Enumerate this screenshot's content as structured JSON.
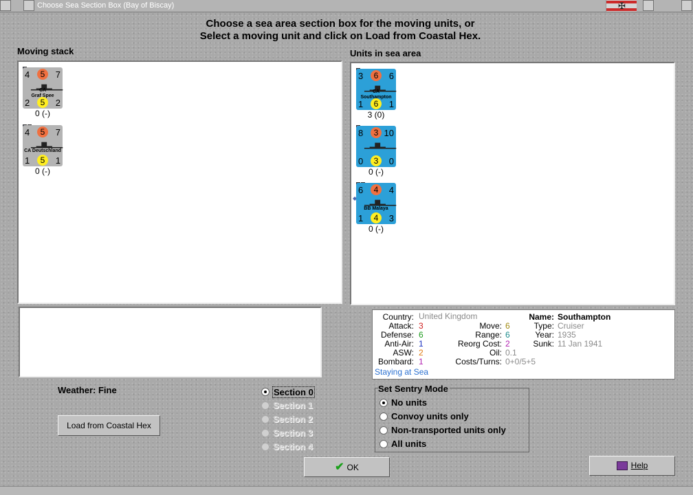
{
  "window": {
    "title": "Choose Sea Section Box (Bay of Biscay)"
  },
  "instructions": {
    "line1": "Choose a sea area section box for the moving units, or",
    "line2": "Select a moving unit and click on Load from Coastal Hex."
  },
  "moving_stack": {
    "label": "Moving stack",
    "units": [
      {
        "tl": "4",
        "tc": "5",
        "tr": "7",
        "class_line1": "CA",
        "class_line2": "Graf Spee",
        "bl": "2",
        "bc": "5",
        "br": "2",
        "below": "0 (-)",
        "color": "#b4b4b4",
        "flag_colors": [
          "#3a4a8a"
        ]
      },
      {
        "tl": "4",
        "tc": "5",
        "tr": "7",
        "class_line1": "",
        "class_line2": "CA Deutschland",
        "bl": "1",
        "bc": "5",
        "br": "1",
        "below": "0 (-)",
        "color": "#b4b4b4",
        "flag_colors": [
          "#3a4a8a",
          "#e08a1a"
        ]
      }
    ]
  },
  "sea_area": {
    "label": "Units in sea area",
    "units": [
      {
        "tl": "3",
        "tc": "6",
        "tr": "6",
        "class_line1": "CA",
        "class_line2": "Southampton",
        "bl": "1",
        "bc": "6",
        "br": "1",
        "below": "3 (0)",
        "color": "#2ca0d8",
        "flag_colors": [
          "#3a4a8a"
        ]
      },
      {
        "tl": "8",
        "tc": "3",
        "tr": "10",
        "class_line1": "",
        "class_line2": "",
        "bl": "0",
        "bc": "3",
        "br": "0",
        "below": "0 (-)",
        "color": "#2ca0d8",
        "flag_colors": [
          "#c0309a"
        ]
      },
      {
        "tl": "6",
        "tc": "4",
        "tr": "4",
        "class_line1": "",
        "class_line2": "BB Malaya",
        "bl": "1",
        "bc": "4",
        "br": "3",
        "below": "0 (-)",
        "color": "#2ca0d8",
        "flag_colors": [
          "#3a4a8a",
          "#e08a1a"
        ]
      }
    ]
  },
  "unit_info": {
    "country_label": "Country:",
    "country": "United Kingdom",
    "attack_label": "Attack:",
    "attack": "3",
    "defense_label": "Defense:",
    "defense": "6",
    "antiair_label": "Anti-Air:",
    "antiair": "1",
    "asw_label": "ASW:",
    "asw": "2",
    "bombard_label": "Bombard:",
    "bombard": "1",
    "move_label": "Move:",
    "move": "6",
    "range_label": "Range:",
    "range": "6",
    "reorg_label": "Reorg Cost:",
    "reorg": "2",
    "oil_label": "Oil:",
    "oil": "0.1",
    "costs_label": "Costs/Turns:",
    "costs": "0+0/5+5",
    "name_label": "Name:",
    "name": "Southampton",
    "type_label": "Type:",
    "type": "Cruiser",
    "year_label": "Year:",
    "year": "1935",
    "sunk_label": "Sunk:",
    "sunk": "11 Jan 1941",
    "status": "Staying at Sea",
    "colors": {
      "country": "#8a8a8a",
      "attack": "#d02020",
      "defense": "#1a9a1a",
      "antiair": "#1a30c0",
      "asw": "#e07a10",
      "bombard": "#b020b0",
      "move": "#a08a10",
      "range": "#1a8a8a",
      "reorg": "#b020b0",
      "oil": "#8a8a8a",
      "costs": "#8a8a8a",
      "grey": "#8a8a8a",
      "status": "#2a70d0"
    }
  },
  "weather": "Weather: Fine",
  "load_button": "Load from Coastal Hex",
  "sections": [
    {
      "label": "Section 0",
      "selected": true,
      "enabled": true
    },
    {
      "label": "Section 1",
      "selected": false,
      "enabled": false
    },
    {
      "label": "Section 2",
      "selected": false,
      "enabled": false
    },
    {
      "label": "Section 3",
      "selected": false,
      "enabled": false
    },
    {
      "label": "Section 4",
      "selected": false,
      "enabled": false
    }
  ],
  "sentry": {
    "title": "Set Sentry Mode",
    "options": [
      {
        "label": "No units",
        "selected": true
      },
      {
        "label": "Convoy units only",
        "selected": false
      },
      {
        "label": "Non-transported units only",
        "selected": false
      },
      {
        "label": "All units",
        "selected": false
      }
    ]
  },
  "ok_button": "OK",
  "help_button": "Help",
  "icons": {
    "ok": "checkmark-icon",
    "help": "book-icon",
    "ship": "warship-icon",
    "flag": "war-ensign-icon"
  }
}
